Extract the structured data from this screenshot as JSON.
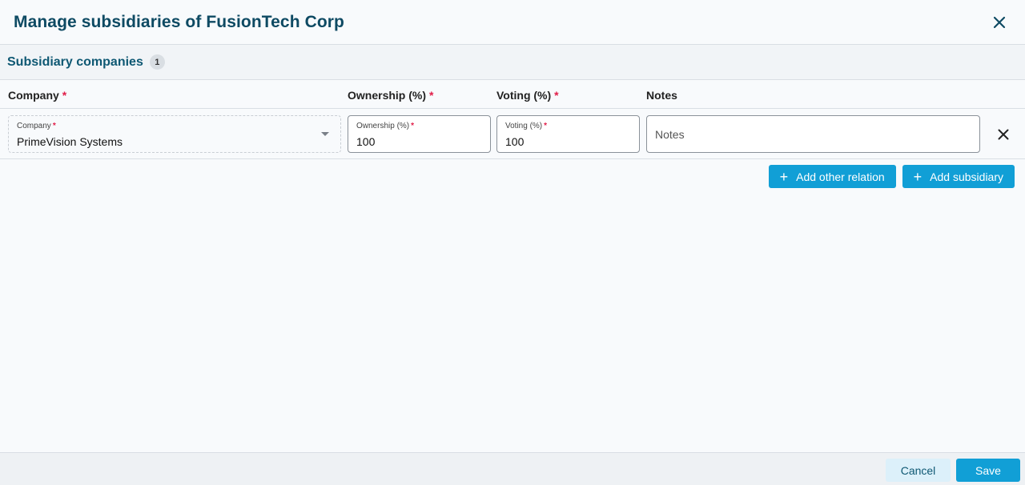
{
  "dialog": {
    "title": "Manage subsidiaries of FusionTech Corp"
  },
  "section": {
    "title": "Subsidiary companies",
    "count": "1"
  },
  "columns": {
    "company": "Company",
    "ownership": "Ownership (%)",
    "voting": "Voting (%)",
    "notes": "Notes",
    "required_mark": "*"
  },
  "rows": [
    {
      "company_label": "Company",
      "company_value": "PrimeVision Systems",
      "ownership_label": "Ownership (%)",
      "ownership_value": "100",
      "voting_label": "Voting (%)",
      "voting_value": "100",
      "notes_placeholder": "Notes"
    }
  ],
  "actions": {
    "add_other_relation": "Add other relation",
    "add_subsidiary": "Add subsidiary",
    "plus_glyph": "+"
  },
  "footer": {
    "cancel": "Cancel",
    "save": "Save"
  },
  "icons": {
    "close": "close-icon",
    "remove": "close-icon",
    "dropdown": "chevron-down-icon",
    "add": "plus-icon"
  },
  "colors": {
    "title": "#0e4a63",
    "accent": "#119fd6",
    "required": "#e11d48"
  }
}
